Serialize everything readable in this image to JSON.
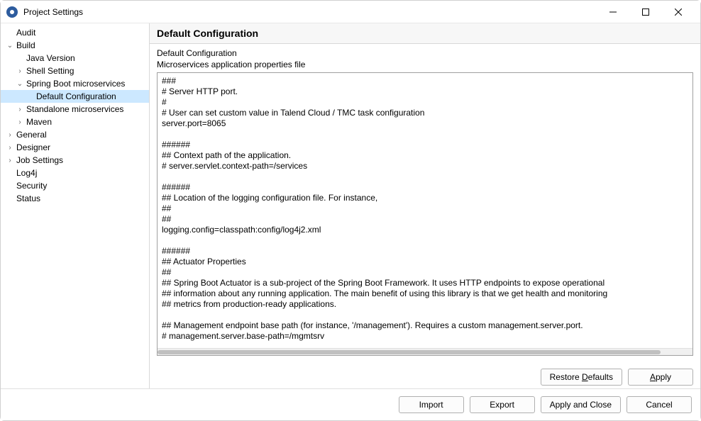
{
  "titlebar": {
    "title": "Project Settings"
  },
  "tree": [
    {
      "label": "Audit",
      "level": 0,
      "toggle": "",
      "selected": false
    },
    {
      "label": "Build",
      "level": 0,
      "toggle": "v",
      "selected": false
    },
    {
      "label": "Java Version",
      "level": 1,
      "toggle": "",
      "selected": false
    },
    {
      "label": "Shell Setting",
      "level": 1,
      "toggle": ">",
      "selected": false
    },
    {
      "label": "Spring Boot microservices",
      "level": 1,
      "toggle": "v",
      "selected": false
    },
    {
      "label": "Default Configuration",
      "level": 2,
      "toggle": "",
      "selected": true
    },
    {
      "label": "Standalone microservices",
      "level": 1,
      "toggle": ">",
      "selected": false
    },
    {
      "label": "Maven",
      "level": 1,
      "toggle": ">",
      "selected": false
    },
    {
      "label": "General",
      "level": 0,
      "toggle": ">",
      "selected": false
    },
    {
      "label": "Designer",
      "level": 0,
      "toggle": ">",
      "selected": false
    },
    {
      "label": "Job Settings",
      "level": 0,
      "toggle": ">",
      "selected": false
    },
    {
      "label": "Log4j",
      "level": 0,
      "toggle": "",
      "selected": false
    },
    {
      "label": "Security",
      "level": 0,
      "toggle": "",
      "selected": false
    },
    {
      "label": "Status",
      "level": 0,
      "toggle": "",
      "selected": false
    }
  ],
  "panel": {
    "header": "Default Configuration",
    "subheading": "Default Configuration",
    "description": "Microservices application properties file",
    "text": "###\n# Server HTTP port.\n#\n# User can set custom value in Talend Cloud / TMC task configuration\nserver.port=8065\n\n######\n## Context path of the application.\n# server.servlet.context-path=/services\n\n######\n## Location of the logging configuration file. For instance,\n##\n##\nlogging.config=classpath:config/log4j2.xml\n\n######\n## Actuator Properties\n##\n## Spring Boot Actuator is a sub-project of the Spring Boot Framework. It uses HTTP endpoints to expose operational\n## information about any running application. The main benefit of using this library is that we get health and monitoring\n## metrics from production-ready applications.\n\n## Management endpoint base path (for instance, '/management'). Requires a custom management.server.port.\n# management.server.base-path=/mgmtsrv"
  },
  "buttons": {
    "restore_defaults_pre": "Restore ",
    "restore_defaults_u": "D",
    "restore_defaults_post": "efaults",
    "apply_u": "A",
    "apply_post": "pply",
    "import": "Import",
    "export": "Export",
    "apply_close": "Apply and Close",
    "cancel": "Cancel"
  }
}
